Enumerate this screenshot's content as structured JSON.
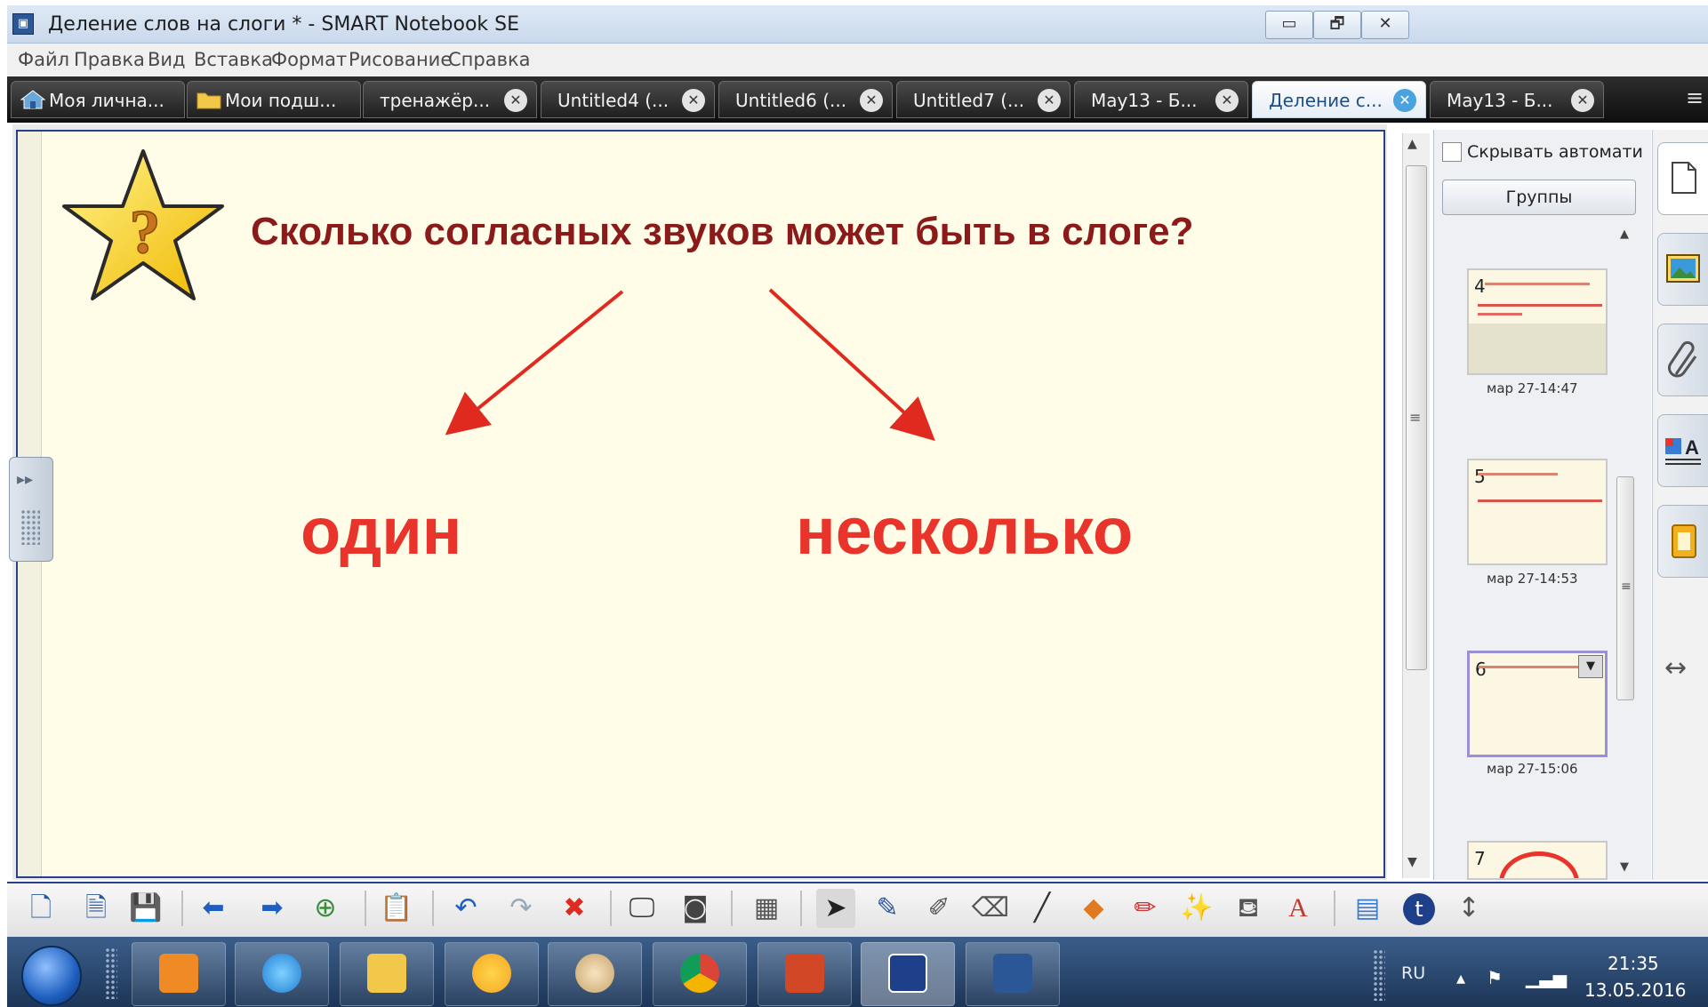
{
  "window": {
    "title": "Деление слов на слоги * - SMART Notebook SE",
    "minimize_label": "▭",
    "restore_label": "🗗",
    "close_label": "✕"
  },
  "menu": [
    "Файл",
    "Правка",
    "Вид",
    "Вставка",
    "Формат",
    "Рисование",
    "Справка"
  ],
  "tabs": [
    {
      "label": "Моя лична...",
      "icon": "house-icon",
      "closable": false
    },
    {
      "label": "Мои подш...",
      "icon": "folder-icon",
      "closable": false
    },
    {
      "label": "тренажёр...",
      "closable": true
    },
    {
      "label": "Untitled4 (...",
      "closable": true
    },
    {
      "label": "Untitled6 (...",
      "closable": true
    },
    {
      "label": "Untitled7 (...",
      "closable": true
    },
    {
      "label": "May13 - Б...",
      "closable": true
    },
    {
      "label": "Деление с...",
      "closable": true,
      "active": true
    },
    {
      "label": "May13 - Б...",
      "closable": true
    }
  ],
  "slide": {
    "question": "Сколько согласных звуков может быть в слоге?",
    "answer_one": "один",
    "answer_many": "несколько",
    "star_symbol": "?"
  },
  "sorter": {
    "autohide_label": "Скрывать автомати",
    "groups_button": "Группы",
    "pages": [
      {
        "number": "4",
        "date": "мар 27-14:47"
      },
      {
        "number": "5",
        "date": "мар 27-14:53"
      },
      {
        "number": "6",
        "date": "мар 27-15:06",
        "selected": true
      },
      {
        "number": "7",
        "date": ""
      }
    ]
  },
  "side_tabs": [
    "page-sorter-icon",
    "gallery-icon",
    "attachments-icon",
    "properties-icon",
    "addons-icon"
  ],
  "taskbar": {
    "lang": "RU",
    "time": "21:35",
    "date": "13.05.2016"
  },
  "colors": {
    "question": "#8b1a1a",
    "answers": "#e8342b",
    "arrows": "#e02a20",
    "canvas": "#fffde8",
    "canvas_border": "#27408b"
  }
}
